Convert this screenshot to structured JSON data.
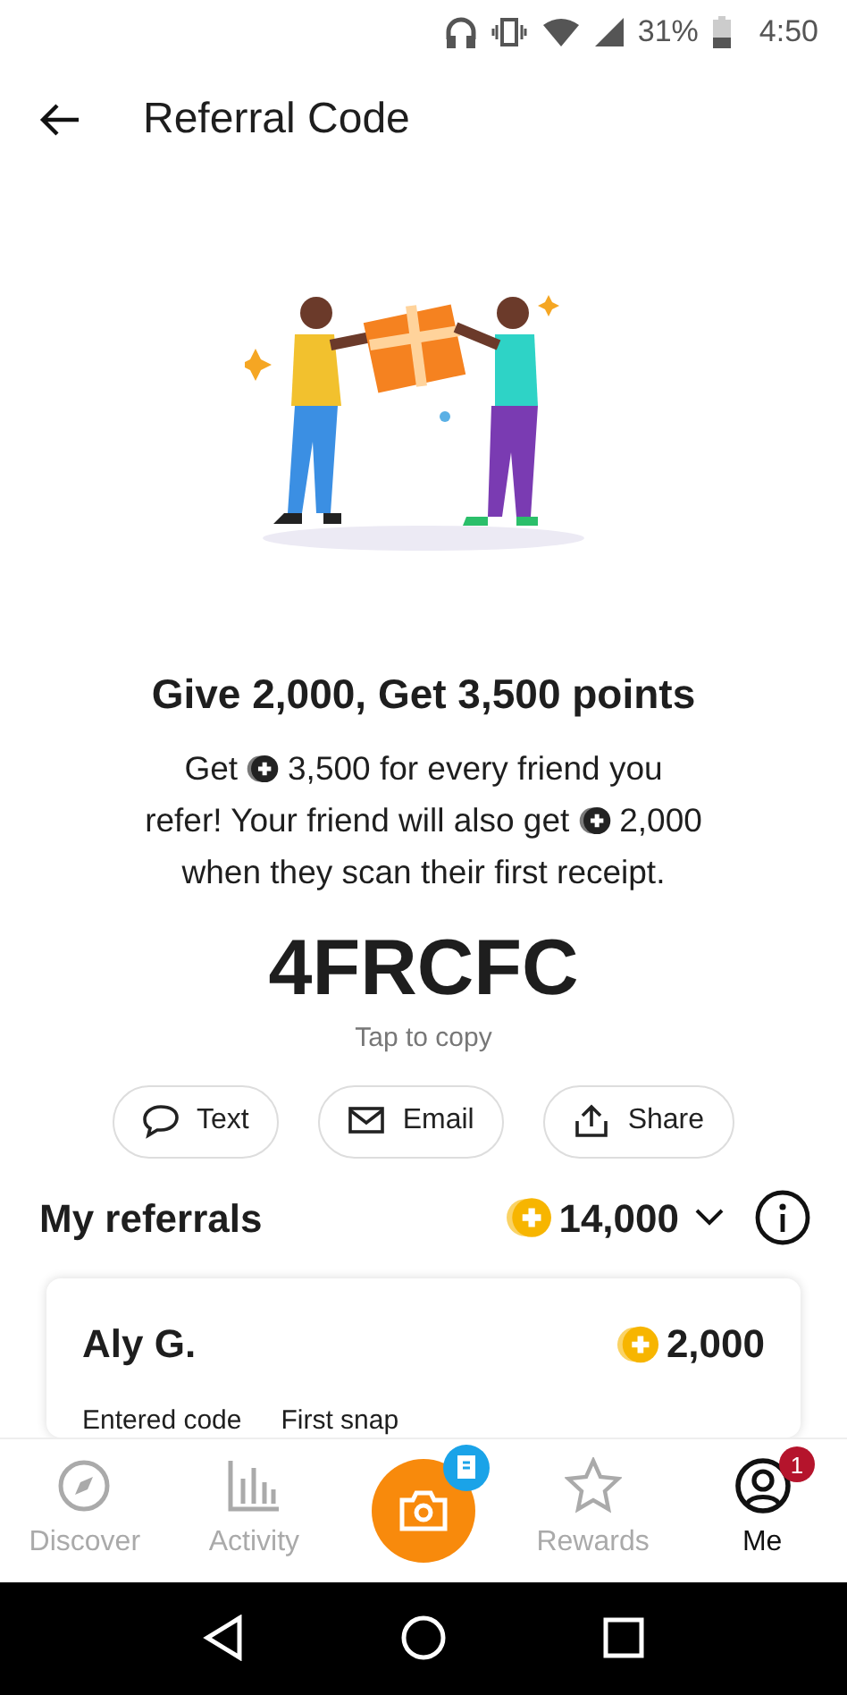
{
  "status_bar": {
    "battery": "31%",
    "time": "4:50"
  },
  "header": {
    "title": "Referral Code"
  },
  "headline": "Give 2,000, Get 3,500 points",
  "description_lines": [
    [
      {
        "kind": "text",
        "text": "Get"
      },
      {
        "kind": "coin"
      },
      {
        "kind": "text",
        "text": "3,500 for every friend you"
      }
    ],
    [
      {
        "kind": "text",
        "text": "refer! Your friend will also get"
      },
      {
        "kind": "coin"
      },
      {
        "kind": "text",
        "text": "2,000"
      }
    ],
    [
      {
        "kind": "text",
        "text": "when they scan their first receipt."
      }
    ]
  ],
  "code": "4FRCFC",
  "copy_hint": "Tap to copy",
  "share_buttons": [
    {
      "kind": "text",
      "label": "Text"
    },
    {
      "kind": "email",
      "label": "Email"
    },
    {
      "kind": "share",
      "label": "Share"
    }
  ],
  "referrals": {
    "title": "My referrals",
    "total": "14,000",
    "items": [
      {
        "name": "Aly G.",
        "points": "2,000",
        "steps": [
          "Entered code",
          "First snap"
        ]
      }
    ]
  },
  "bottom_nav": [
    {
      "kind": "discover",
      "label": "Discover",
      "selected": false
    },
    {
      "kind": "activity",
      "label": "Activity",
      "selected": false
    },
    {
      "kind": "camera",
      "selected": false
    },
    {
      "kind": "rewards",
      "label": "Rewards",
      "selected": false
    },
    {
      "kind": "me",
      "label": "Me",
      "selected": true,
      "badge": "1"
    }
  ]
}
